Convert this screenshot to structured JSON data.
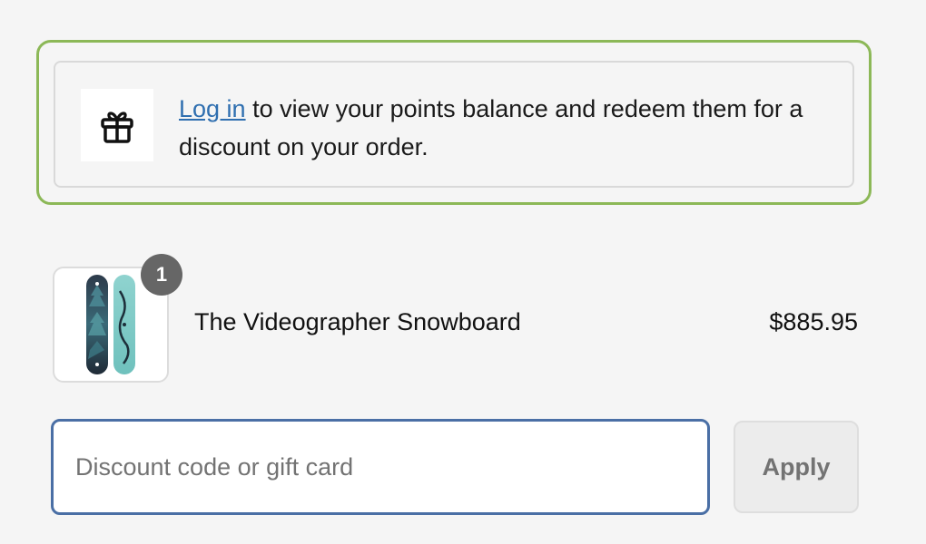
{
  "loyalty": {
    "icon": "gift-icon",
    "login_link": "Log in",
    "message": " to view your points balance and redeem them for a discount on your order.",
    "border_color": "#8cb857",
    "link_color": "#2f6fb0"
  },
  "line_item": {
    "quantity": "1",
    "name": "The Videographer Snowboard",
    "price": "$885.95",
    "image_icon": "snowboard-image"
  },
  "discount": {
    "placeholder": "Discount code or gift card",
    "value": "",
    "apply_label": "Apply",
    "focus_color": "#4a6fa5"
  }
}
